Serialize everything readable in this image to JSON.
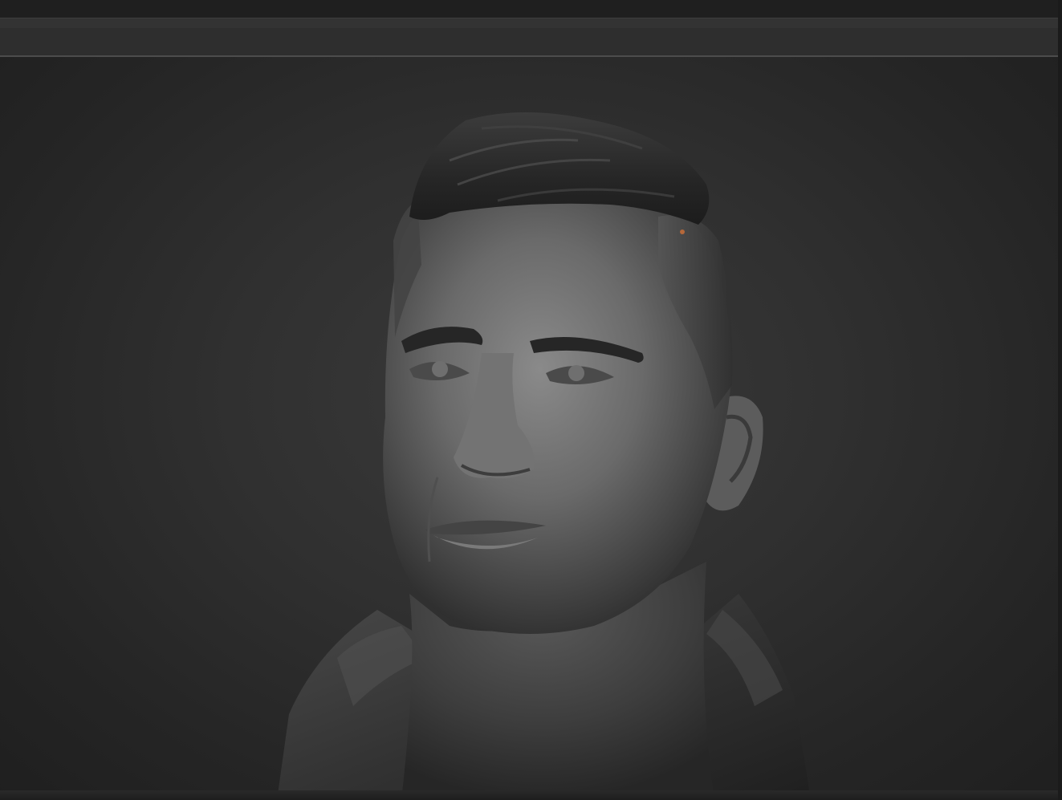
{
  "app": {
    "name": "sculpt-viewport"
  },
  "canvas": {
    "subject": "",
    "material_color": "#6b6b6b",
    "background_color": "#2c2c2c"
  },
  "icons": {
    "model": "head-bust-icon"
  }
}
